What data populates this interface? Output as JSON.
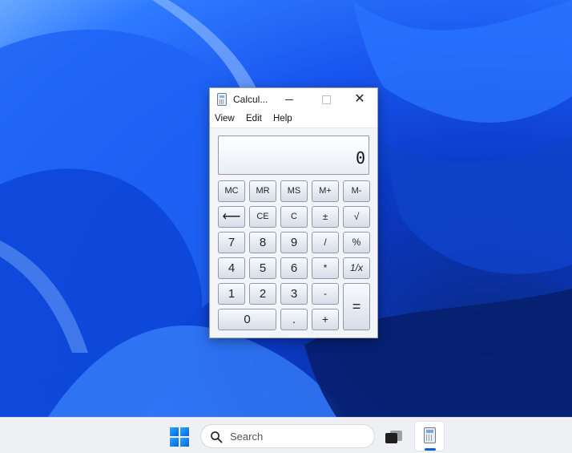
{
  "window": {
    "title": "Calcul...",
    "close_glyph": "✕",
    "icons": {
      "app": "calculator-icon",
      "minimize": "minimize-icon",
      "maximize": "maximize-icon",
      "close": "close-icon"
    }
  },
  "menu": {
    "view": "View",
    "edit": "Edit",
    "help": "Help"
  },
  "display": {
    "value": "0"
  },
  "keys": {
    "mc": "MC",
    "mr": "MR",
    "ms": "MS",
    "mplus": "M+",
    "mminus": "M-",
    "backspace": "⟵",
    "ce": "CE",
    "c": "C",
    "plusminus": "±",
    "sqrt": "√",
    "k7": "7",
    "k8": "8",
    "k9": "9",
    "divide": "/",
    "percent": "%",
    "k4": "4",
    "k5": "5",
    "k6": "6",
    "multiply": "*",
    "reciprocal": "1/x",
    "k1": "1",
    "k2": "2",
    "k3": "3",
    "minus": "-",
    "equals": "=",
    "k0": "0",
    "decimal": ".",
    "plus": "+"
  },
  "taskbar": {
    "search_placeholder": "Search",
    "icons": {
      "start": "windows-start-icon",
      "search": "search-icon",
      "taskview": "task-view-icon",
      "calculator": "calculator-icon"
    },
    "accent": "#0a63d8"
  }
}
